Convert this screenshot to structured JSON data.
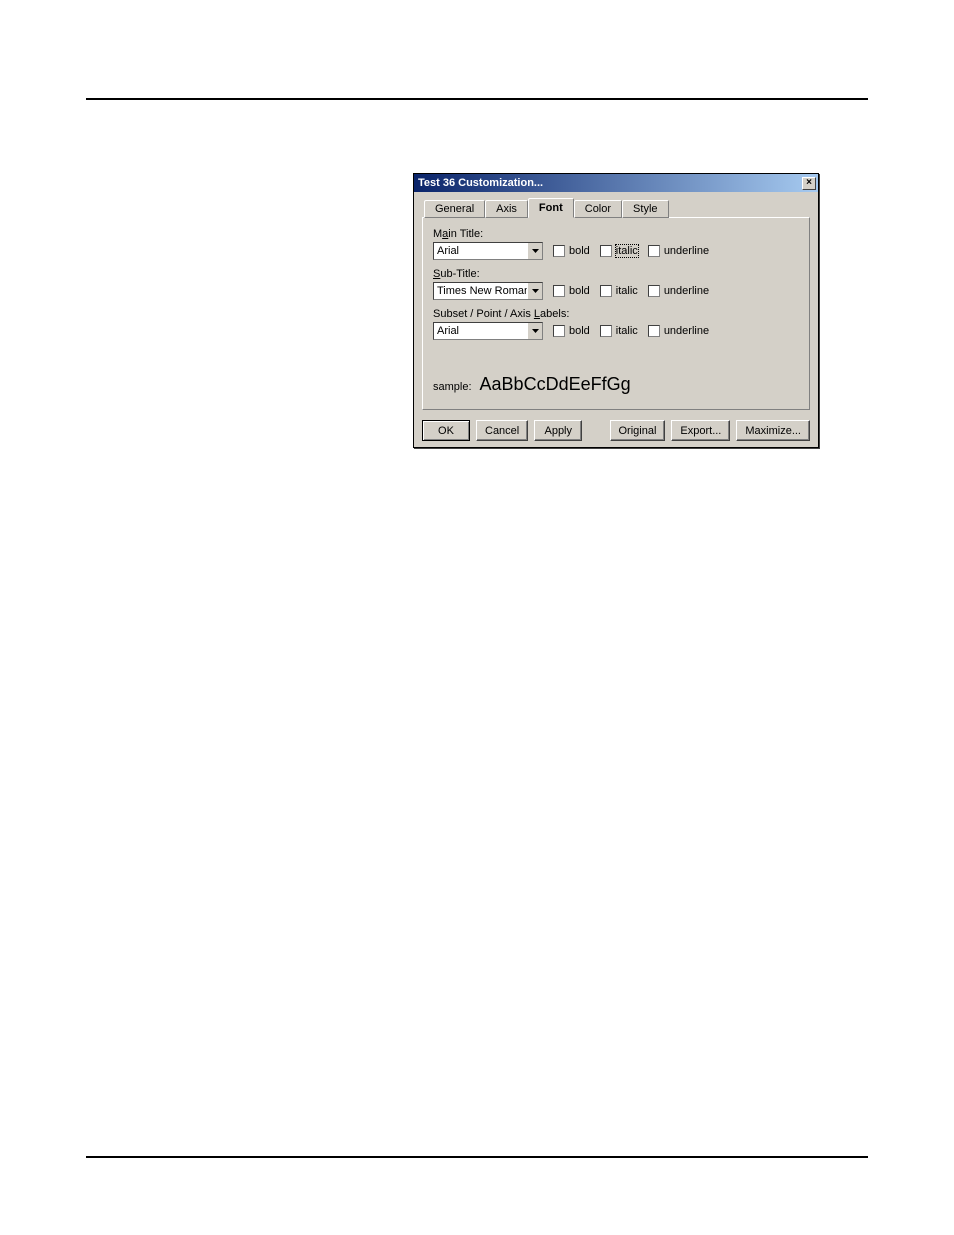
{
  "dialog": {
    "title": "Test 36 Customization...",
    "close_glyph": "×",
    "tabs": {
      "general": "General",
      "axis": "Axis",
      "font": "Font",
      "color": "Color",
      "style": "Style"
    },
    "font_panel": {
      "main_title": {
        "label_pre": "M",
        "label_u": "a",
        "label_post": "in Title:",
        "value": "Arial"
      },
      "sub_title": {
        "label_pre": "",
        "label_u": "S",
        "label_post": "ub-Title:",
        "value": "Times New Roman"
      },
      "labels": {
        "label_pre": "Subset / Point / Axis ",
        "label_u": "L",
        "label_post": "abels:",
        "value": "Arial"
      },
      "checks": {
        "bold": "bold",
        "italic": "italic",
        "underline": "underline"
      },
      "sample_label": "sample:",
      "sample_text": "AaBbCcDdEeFfGg"
    },
    "buttons": {
      "ok": "OK",
      "cancel": "Cancel",
      "apply": "Apply",
      "original": "Original",
      "export": "Export...",
      "maximize": "Maximize..."
    }
  }
}
